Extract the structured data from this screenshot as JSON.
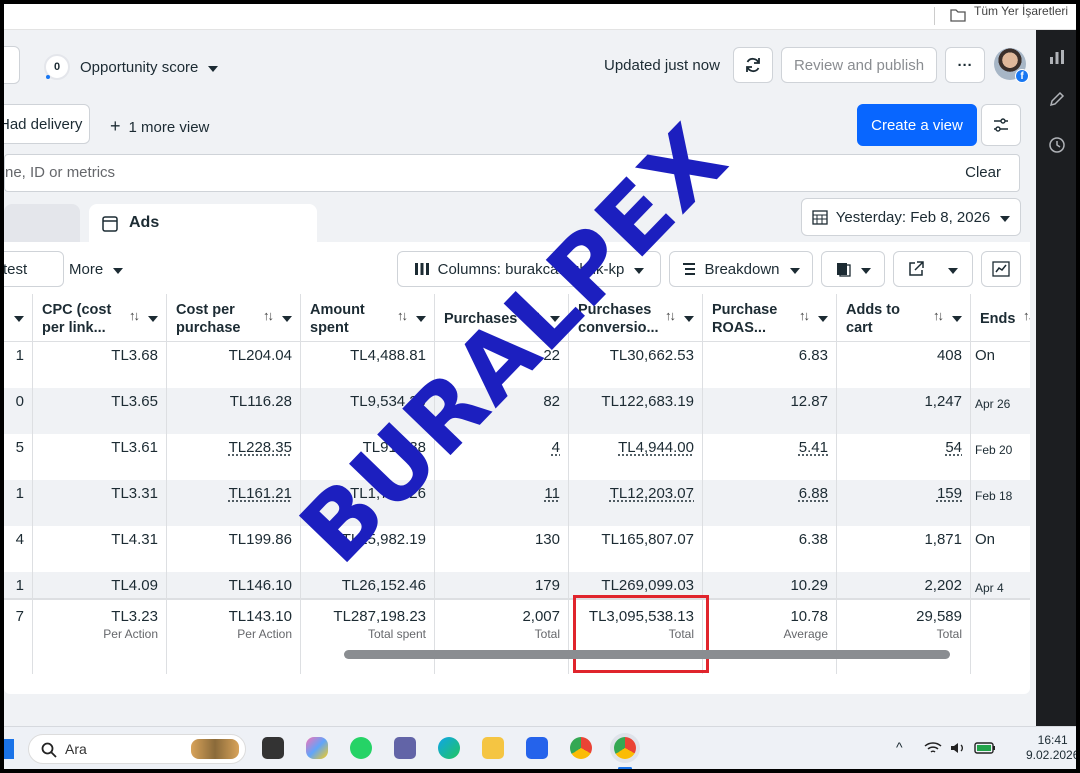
{
  "bookmarks": {
    "label": "Tüm Yer İşaretleri",
    "icon": "folder-icon"
  },
  "topbar": {
    "opportunity_score_value": "0",
    "opportunity_score_label": "Opportunity score",
    "updated_text": "Updated just now",
    "review_publish_label": "Review and publish",
    "more_label": "···"
  },
  "views": {
    "had_delivery_label": "Had delivery",
    "more_view_label": "1 more view",
    "create_view_label": "Create a view"
  },
  "search": {
    "placeholder": "ne, ID or metrics",
    "clear_label": "Clear"
  },
  "tabs": {
    "ads_label": "Ads"
  },
  "date_range": {
    "label": "Yesterday: Feb 8, 2026"
  },
  "toolbar": {
    "test_label": "test",
    "more_label": "More",
    "columns_label": "Columns: burakca...ubuk-kp",
    "breakdown_label": "Breakdown"
  },
  "table": {
    "columns": [
      {
        "label": "CPC (cost per link..."
      },
      {
        "label": "Cost per purchase"
      },
      {
        "label": "Amount spent"
      },
      {
        "label": "Purchases"
      },
      {
        "label": "Purchases conversio..."
      },
      {
        "label": "Purchase ROAS..."
      },
      {
        "label": "Adds to cart"
      },
      {
        "label": "Ends"
      }
    ],
    "rows": [
      {
        "edge": "1",
        "cpc": "TL3.68",
        "cpp": "TL204.04",
        "spent": "TL4,488.81",
        "purchases": "22",
        "conv": "TL30,662.53",
        "roas": "6.83",
        "atc": "408",
        "ends": "On"
      },
      {
        "edge": "0",
        "cpc": "TL3.65",
        "cpp": "TL116.28",
        "spent": "TL9,534.20",
        "purchases": "82",
        "conv": "TL122,683.19",
        "roas": "12.87",
        "atc": "1,247",
        "ends": "Apr 26"
      },
      {
        "edge": "5",
        "cpc": "TL3.61",
        "cpp": "TL228.35",
        "spent": "TL913.38",
        "purchases": "4",
        "conv": "TL4,944.00",
        "roas": "5.41",
        "atc": "54",
        "ends": "Feb 20"
      },
      {
        "edge": "1",
        "cpc": "TL3.31",
        "cpp": "TL161.21",
        "spent": "TL1,773.26",
        "purchases": "11",
        "conv": "TL12,203.07",
        "roas": "6.88",
        "atc": "159",
        "ends": "Feb 18"
      },
      {
        "edge": "4",
        "cpc": "TL4.31",
        "cpp": "TL199.86",
        "spent": "TL25,982.19",
        "purchases": "130",
        "conv": "TL165,807.07",
        "roas": "6.38",
        "atc": "1,871",
        "ends": "On"
      },
      {
        "edge": "1",
        "cpc": "TL4.09",
        "cpp": "TL146.10",
        "spent": "TL26,152.46",
        "purchases": "179",
        "conv": "TL269,099.03",
        "roas": "10.29",
        "atc": "2,202",
        "ends": "Apr 4"
      }
    ],
    "totals": {
      "edge": "7",
      "cpc": {
        "value": "TL3.23",
        "sub": "Per Action"
      },
      "cpp": {
        "value": "TL143.10",
        "sub": "Per Action"
      },
      "spent": {
        "value": "TL287,198.23",
        "sub": "Total spent"
      },
      "purchases": {
        "value": "2,007",
        "sub": "Total"
      },
      "conv": {
        "value": "TL3,095,538.13",
        "sub": "Total"
      },
      "roas": {
        "value": "10.78",
        "sub": "Average"
      },
      "atc": {
        "value": "29,589",
        "sub": "Total"
      }
    }
  },
  "watermark": "BURALPEX",
  "taskbar": {
    "search_label": "Ara",
    "time": "16:41",
    "date": "9.02.2026"
  },
  "colors": {
    "primary": "#0866ff",
    "highlight": "#e0242c",
    "watermark": "#1c1fbf"
  }
}
